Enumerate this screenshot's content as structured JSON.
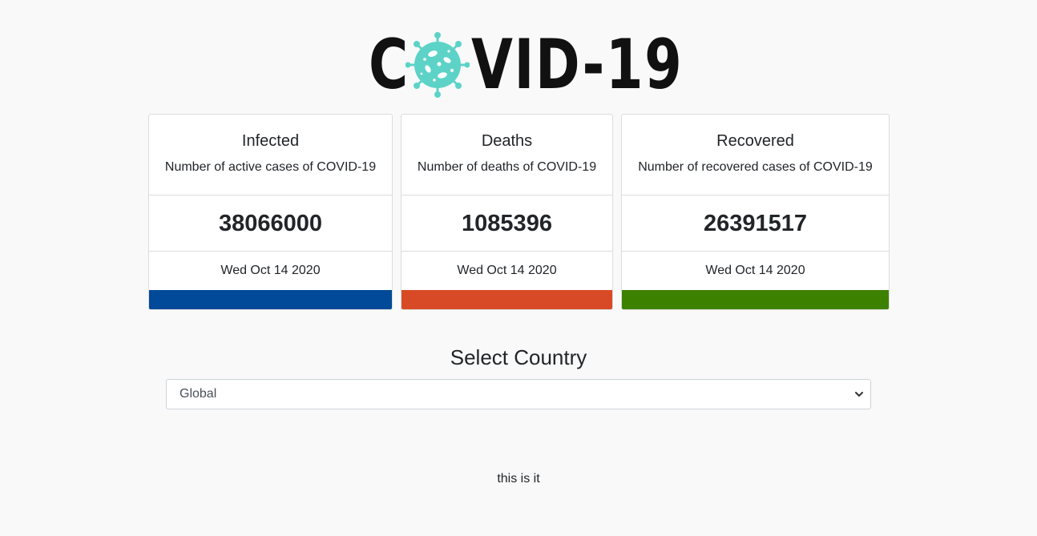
{
  "logo": {
    "text_start": "C",
    "text_end": "VID-19",
    "icon": "virus-icon",
    "icon_color": "#5dd3c8"
  },
  "cards": [
    {
      "title": "Infected",
      "subtitle": "Number of active cases of COVID-19",
      "value": "38066000",
      "date": "Wed Oct 14 2020",
      "color": "#004a99"
    },
    {
      "title": "Deaths",
      "subtitle": "Number of deaths of COVID-19",
      "value": "1085396",
      "date": "Wed Oct 14 2020",
      "color": "#d84a25"
    },
    {
      "title": "Recovered",
      "subtitle": "Number of recovered cases of COVID-19",
      "value": "26391517",
      "date": "Wed Oct 14 2020",
      "color": "#3d8100"
    }
  ],
  "country_select": {
    "title": "Select Country",
    "selected": "Global",
    "icon": "chevron-down-icon"
  },
  "footer": {
    "text": "this is it"
  }
}
